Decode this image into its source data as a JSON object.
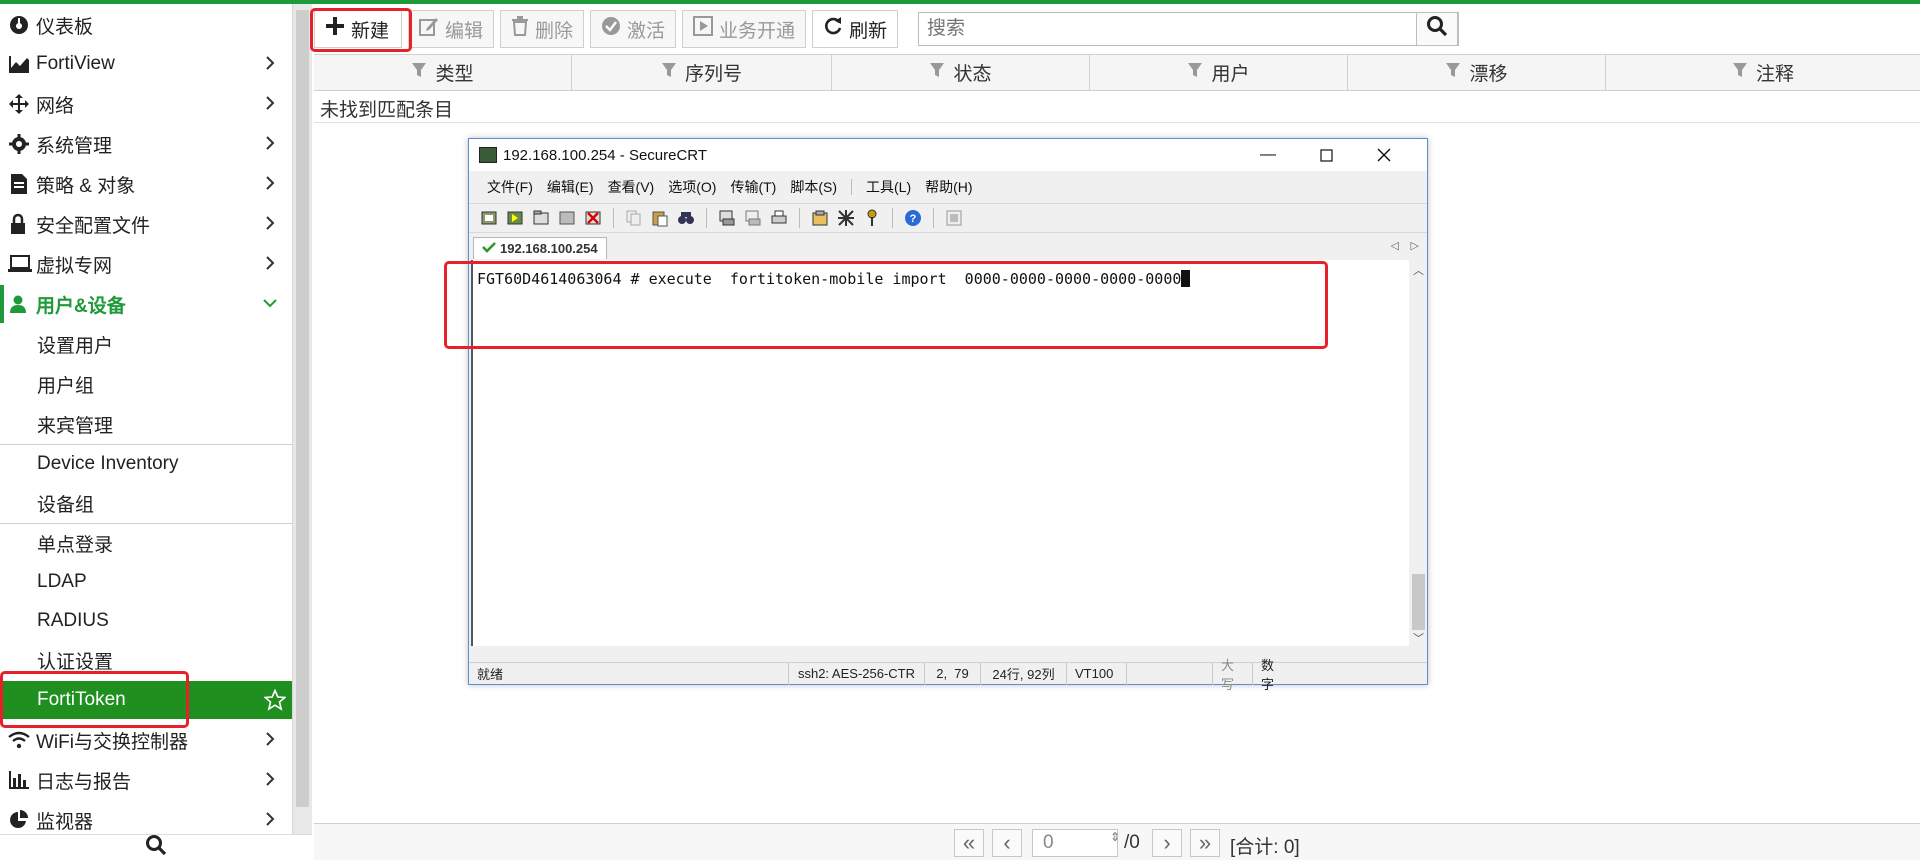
{
  "sidebar": {
    "items": [
      {
        "label": "仪表板",
        "icon": "dashboard-icon",
        "has_chevron": false
      },
      {
        "label": "FortiView",
        "icon": "chart-area-icon",
        "has_chevron": true
      },
      {
        "label": "网络",
        "icon": "network-arrows-icon",
        "has_chevron": true
      },
      {
        "label": "系统管理",
        "icon": "gear-icon",
        "has_chevron": true
      },
      {
        "label": "策略 & 对象",
        "icon": "policy-document-icon",
        "has_chevron": true
      },
      {
        "label": "安全配置文件",
        "icon": "lock-icon",
        "has_chevron": true
      },
      {
        "label": "虚拟专网",
        "icon": "laptop-icon",
        "has_chevron": true
      },
      {
        "label": "用户&设备",
        "icon": "user-icon",
        "has_chevron": true,
        "open": true
      }
    ],
    "sub_items": [
      "设置用户",
      "用户组",
      "来宾管理",
      "Device Inventory",
      "设备组",
      "单点登录",
      "LDAP",
      "RADIUS",
      "认证设置",
      "FortiToken"
    ],
    "active_sub": "FortiToken",
    "items_after": [
      {
        "label": "WiFi与交换控制器",
        "icon": "wifi-icon"
      },
      {
        "label": "日志与报告",
        "icon": "bar-chart-icon"
      },
      {
        "label": "监视器",
        "icon": "pie-chart-icon"
      }
    ]
  },
  "toolbar": {
    "new_label": "新建",
    "edit_label": "编辑",
    "delete_label": "删除",
    "activate_label": "激活",
    "provision_label": "业务开通",
    "refresh_label": "刷新",
    "search_placeholder": "搜索"
  },
  "table": {
    "columns": [
      "类型",
      "序列号",
      "状态",
      "用户",
      "漂移",
      "注释"
    ],
    "empty_message": "未找到匹配条目"
  },
  "pager": {
    "current_page": "0",
    "total_pages": "/0",
    "total_label": "[合计: 0]"
  },
  "securecrt": {
    "title": "192.168.100.254 - SecureCRT",
    "menu": [
      "文件(F)",
      "编辑(E)",
      "查看(V)",
      "选项(O)",
      "传输(T)",
      "脚本(S)",
      "工具(L)",
      "帮助(H)"
    ],
    "tab_label": "192.168.100.254",
    "command_line": "FGT60D4614063064 # execute  fortitoken-mobile import  0000-0000-0000-0000-0000",
    "status": {
      "ready": "就绪",
      "cipher": "ssh2: AES-256-CTR",
      "position": "2,  79",
      "size": "24行, 92列",
      "terminal": "VT100",
      "caps": "大写",
      "num": "数字"
    }
  },
  "colors": {
    "accent_green": "#1f9a3a",
    "highlight_red": "#e8202a",
    "window_border": "#5a8fd8"
  }
}
